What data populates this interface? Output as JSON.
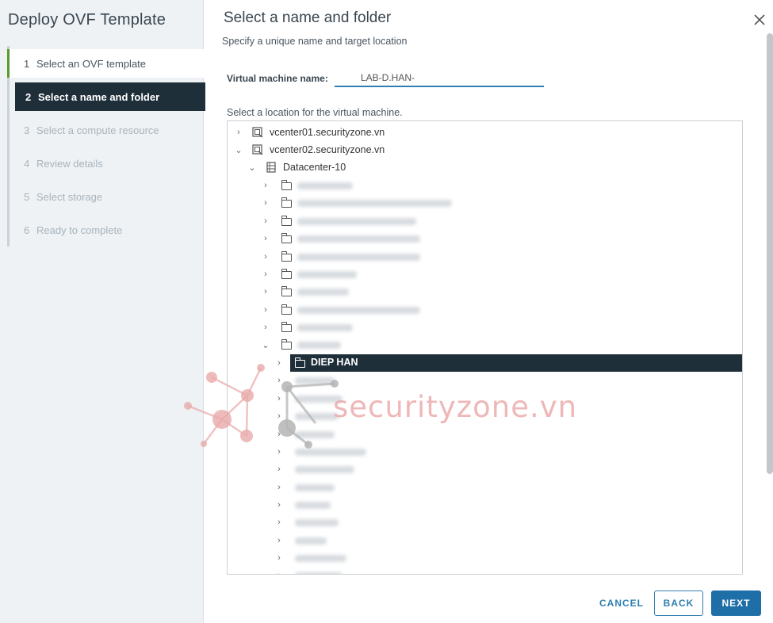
{
  "wizard": {
    "title": "Deploy OVF Template",
    "steps": [
      {
        "num": "1",
        "label": "Select an OVF template",
        "state": "done"
      },
      {
        "num": "2",
        "label": "Select a name and folder",
        "state": "active"
      },
      {
        "num": "3",
        "label": "Select a compute resource",
        "state": "pending"
      },
      {
        "num": "4",
        "label": "Review details",
        "state": "pending"
      },
      {
        "num": "5",
        "label": "Select storage",
        "state": "pending"
      },
      {
        "num": "6",
        "label": "Ready to complete",
        "state": "pending"
      }
    ]
  },
  "page": {
    "title": "Select a name and folder",
    "subtitle": "Specify a unique name and target location",
    "close_icon": "close-icon"
  },
  "form": {
    "vm_name_label": "Virtual machine name:",
    "vm_name_value": "LAB-D.HAN-",
    "location_label": "Select a location for the virtual machine."
  },
  "tree": {
    "vcenter1": "vcenter01.securityzone.vn",
    "vcenter2": "vcenter02.securityzone.vn",
    "datacenter": "Datacenter-10",
    "selected_folder": "DIEP HAN"
  },
  "watermark": {
    "text": "securityzone.vn"
  },
  "footer": {
    "cancel": "CANCEL",
    "back": "BACK",
    "next": "NEXT"
  },
  "colors": {
    "accent": "#1e6fa8",
    "selected_bg": "#1f2f3a",
    "done_marker": "#5a9a2a"
  }
}
